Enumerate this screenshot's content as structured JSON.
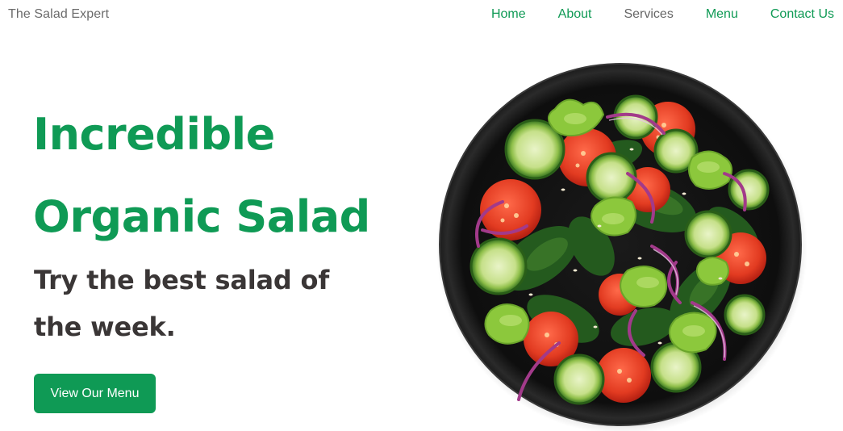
{
  "header": {
    "brand": "The Salad Expert",
    "nav": [
      {
        "label": "Home"
      },
      {
        "label": "About"
      },
      {
        "label": "Services"
      },
      {
        "label": "Menu"
      },
      {
        "label": "Contact Us"
      }
    ]
  },
  "hero": {
    "title_line1": "Incredible",
    "title_line2": "Organic Salad",
    "subtitle_line1": "Try the best salad of",
    "subtitle_line2": "the week.",
    "cta_label": "View Our Menu",
    "image_icon": "salad-bowl-image"
  },
  "colors": {
    "accent": "#0f9a55",
    "brand_text": "#6b6b6b",
    "nav_muted": "#666666",
    "heading_dark": "#3a3636",
    "bowl": "#111111"
  }
}
